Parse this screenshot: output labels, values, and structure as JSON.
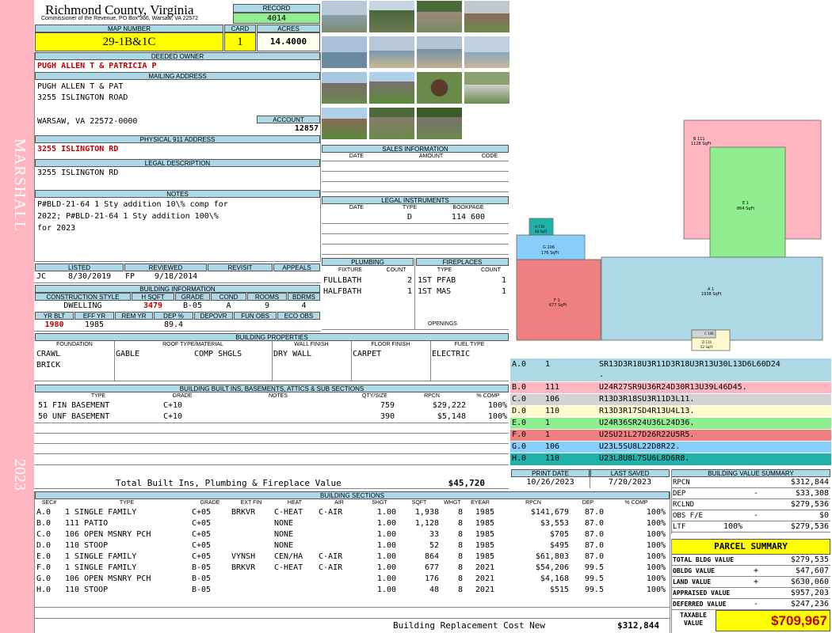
{
  "sidebar": {
    "name": "MARSHALL",
    "year": "2023"
  },
  "header": {
    "county": "Richmond County, Virginia",
    "commissioner": "Commissioner of the Revenue, PO Box 366, Warsaw, VA 22572",
    "record_label": "RECORD",
    "record": "4014",
    "map_label": "MAP NUMBER",
    "map_number": "29-1B&1C",
    "card_label": "CARD",
    "card": "1",
    "acres_label": "ACRES",
    "acres": "14.4000"
  },
  "owner": {
    "deeded_label": "DEEDED OWNER",
    "deeded": "PUGH ALLEN T & PATRICIA P",
    "mailing_label": "MAILING ADDRESS",
    "mail_name": "PUGH ALLEN T & PAT",
    "mail_street": "3255 ISLINGTON ROAD",
    "mail_city": "WARSAW, VA 22572-0000",
    "account_label": "ACCOUNT",
    "account": "12857",
    "physical_label": "PHYSICAL 911 ADDRESS",
    "physical": "3255 ISLINGTON RD",
    "legal_label": "LEGAL DESCRIPTION",
    "legal": "3255 ISLINGTON RD"
  },
  "notes": {
    "label": "NOTES",
    "lines": [
      "P#BLD-21-64 1 Sty addition 10\\% comp for",
      "2022; P#BLD-21-64 1 Sty addition 100\\%",
      "for 2023"
    ]
  },
  "listing": {
    "listed_label": "LISTED",
    "reviewed_label": "REVIEWED",
    "revisit_label": "REVISIT",
    "appeals_label": "APPEALS",
    "listed_by": "JC",
    "listed_date": "8/30/2019",
    "reviewed_by": "FP",
    "reviewed_date": "9/18/2014"
  },
  "building_info": {
    "label": "BUILDING INFORMATION",
    "cols": [
      "CONSTRUCTION STYLE",
      "H SQFT",
      "GRADE",
      "COND",
      "ROOMS",
      "BDRMS"
    ],
    "vals": [
      "DWELLING",
      "3479",
      "B-05",
      "A",
      "9",
      "4"
    ],
    "cols2": [
      "YR BLT",
      "EFF YR",
      "REM YR",
      "DEP %",
      "DEPOVR",
      "FUN OBS",
      "ECO OBS"
    ],
    "vals2": [
      "1980",
      "1985",
      "",
      "89.4",
      "",
      "",
      ""
    ]
  },
  "sales": {
    "label": "SALES INFORMATION",
    "cols": [
      "DATE",
      "AMOUNT",
      "CODE"
    ]
  },
  "legal_instr": {
    "label": "LEGAL INSTRUMENTS",
    "cols": [
      "DATE",
      "TYPE",
      "BOOKPAGE"
    ],
    "row": [
      "",
      "D",
      "114 600"
    ]
  },
  "plumbing": {
    "label": "PLUMBING",
    "cols": [
      "FIXTURE",
      "COUNT"
    ],
    "rows": [
      [
        "FULLBATH",
        "2"
      ],
      [
        "HALFBATH",
        "1"
      ]
    ]
  },
  "fireplaces": {
    "label": "FIREPLACES",
    "cols": [
      "TYPE",
      "COUNT"
    ],
    "rows": [
      [
        "1ST PFAB",
        "1"
      ],
      [
        "1ST MAS",
        "1"
      ]
    ],
    "openings_label": "OPENINGS"
  },
  "properties": {
    "label": "BUILDING PROPERTIES",
    "cols": [
      "FOUNDATION",
      "ROOF TYPE/MATERIAL",
      "WALL FINISH",
      "FLOOR FINISH",
      "FUEL TYPE"
    ],
    "foundation1": "CRAWL",
    "foundation2": "BRICK",
    "roof_type": "GABLE",
    "roof_mat": "COMP SHGLS",
    "wall": "DRY WALL",
    "floor": "CARPET",
    "fuel": "ELECTRIC"
  },
  "builtins": {
    "label": "BUILDING BUILT INS, BASEMENTS, ATTICS & SUB SECTIONS",
    "cols": [
      "TYPE",
      "GRADE",
      "NOTES",
      "QTY/SIZE",
      "RPCN",
      "% COMP"
    ],
    "rows": [
      [
        "51 FIN BASEMENT",
        "C+10",
        "",
        "759",
        "$29,222",
        "100%"
      ],
      [
        "50 UNF BASEMENT",
        "C+10",
        "",
        "390",
        "$5,148",
        "100%"
      ]
    ],
    "total_label": "Total Built Ins, Plumbing & Fireplace Value",
    "total": "$45,720"
  },
  "dates": {
    "print_label": "PRINT DATE",
    "saved_label": "LAST SAVED",
    "print": "10/26/2023",
    "saved": "7/20/2023"
  },
  "sections": {
    "label": "BUILDING SECTIONS",
    "cols": [
      "SEC#",
      "TYPE",
      "GRADE",
      "EXT FIN",
      "HEAT",
      "AIR",
      "SHGT",
      "SQFT",
      "WHGT",
      "EYEAR",
      "RPCN",
      "DEP",
      "% COMP"
    ],
    "rows": [
      [
        "A.0",
        "1 SINGLE FAMILY",
        "C+05",
        "BRKVR",
        "C-HEAT",
        "C-AIR",
        "1.00",
        "1,938",
        "8",
        "1985",
        "$141,679",
        "87.0",
        "100%"
      ],
      [
        "B.0",
        "111 PATIO",
        "C+05",
        "",
        "NONE",
        "",
        "1.00",
        "1,128",
        "8",
        "1985",
        "$3,553",
        "87.0",
        "100%"
      ],
      [
        "C.0",
        "106 OPEN MSNRY PCH",
        "C+05",
        "",
        "NONE",
        "",
        "1.00",
        "33",
        "8",
        "1985",
        "$705",
        "87.0",
        "100%"
      ],
      [
        "D.0",
        "110 STOOP",
        "C+05",
        "",
        "NONE",
        "",
        "1.00",
        "52",
        "8",
        "1985",
        "$495",
        "87.0",
        "100%"
      ],
      [
        "E.0",
        "1 SINGLE FAMILY",
        "C+05",
        "VYNSH",
        "CEN/HA",
        "C-AIR",
        "1.00",
        "864",
        "8",
        "1985",
        "$61,803",
        "87.0",
        "100%"
      ],
      [
        "F.0",
        "1 SINGLE FAMILY",
        "B-05",
        "BRKVR",
        "C-HEAT",
        "C-AIR",
        "1.00",
        "677",
        "8",
        "2021",
        "$54,206",
        "99.5",
        "100%"
      ],
      [
        "G.0",
        "106 OPEN MSNRY PCH",
        "B-05",
        "",
        "",
        "",
        "1.00",
        "176",
        "8",
        "2021",
        "$4,168",
        "99.5",
        "100%"
      ],
      [
        "H.0",
        "110 STOOP",
        "B-05",
        "",
        "",
        "",
        "1.00",
        "48",
        "8",
        "2021",
        "$515",
        "99.5",
        "100%"
      ]
    ],
    "replacement_label": "Building Replacement Cost New",
    "replacement": "$312,844"
  },
  "sketch_codes": [
    [
      "A.0",
      "1",
      "SR13D3R18U3R11D3R18U3R13U30L13D6L60D24",
      ".",
      "#add8e6"
    ],
    [
      "B.0",
      "111",
      "U24R27SR9U36R24D30R13U39L46D45.",
      "",
      "#ffb6c1"
    ],
    [
      "C.0",
      "106",
      "R13D3R18SU3R11D3L11.",
      "",
      "#d3d3d3"
    ],
    [
      "D.0",
      "110",
      "R13D3R17SD4R13U4L13.",
      "",
      "#fffacd"
    ],
    [
      "E.0",
      "1",
      "U24R36SR24U36L24D36.",
      "",
      "#90ee90"
    ],
    [
      "F.0",
      "1",
      "U2SU21L27D26R22U5R5.",
      "",
      "#f08080"
    ],
    [
      "G.0",
      "106",
      "U23L5SU8L22D8R22.",
      "",
      "#87cefa"
    ],
    [
      "H.0",
      "110",
      "U23L8U8L7SU6L8D6R8.",
      "",
      "#20b2aa"
    ]
  ],
  "sketch_labels": {
    "a": "A 1",
    "a2": "1938 SqFt",
    "b": "B 111",
    "b2": "1128 SqFt",
    "e": "E 1",
    "e2": "864 SqFt",
    "f": "F 1",
    "f2": "677 SqFt",
    "g": "G 106",
    "g2": "176 SqFt",
    "h": "H 110",
    "h2": "48 SqFt",
    "c": "C 106",
    "d": "D 110",
    "d2": "52 SqFt"
  },
  "value_summary": {
    "label": "BUILDING VALUE SUMMARY",
    "rows": [
      [
        "RPCN",
        "",
        "",
        "$312,844"
      ],
      [
        "DEP",
        "-",
        "",
        "$33,308"
      ],
      [
        "RCLND",
        "",
        "",
        "$279,536"
      ],
      [
        "OBS F/E",
        "-",
        "",
        "$0"
      ],
      [
        "LTF",
        "",
        "100%",
        "$279,536"
      ]
    ]
  },
  "parcel": {
    "label": "PARCEL SUMMARY",
    "rows": [
      [
        "TOTAL BLDG VALUE",
        "",
        "$279,535"
      ],
      [
        "OBLDG VALUE",
        "+",
        "$47,607"
      ],
      [
        "LAND VALUE",
        "+",
        "$630,060"
      ],
      [
        "APPRAISED VALUE",
        "",
        "$957,203"
      ],
      [
        "DEFERRED VALUE",
        "-",
        "$247,236"
      ]
    ],
    "taxable_label": "TAXABLE VALUE",
    "taxable": "$709,967"
  },
  "colors": {
    "header": "#add8e6",
    "sidebar": "#ffb6c1",
    "yellow": "#ffff00",
    "green": "#90ee90"
  }
}
